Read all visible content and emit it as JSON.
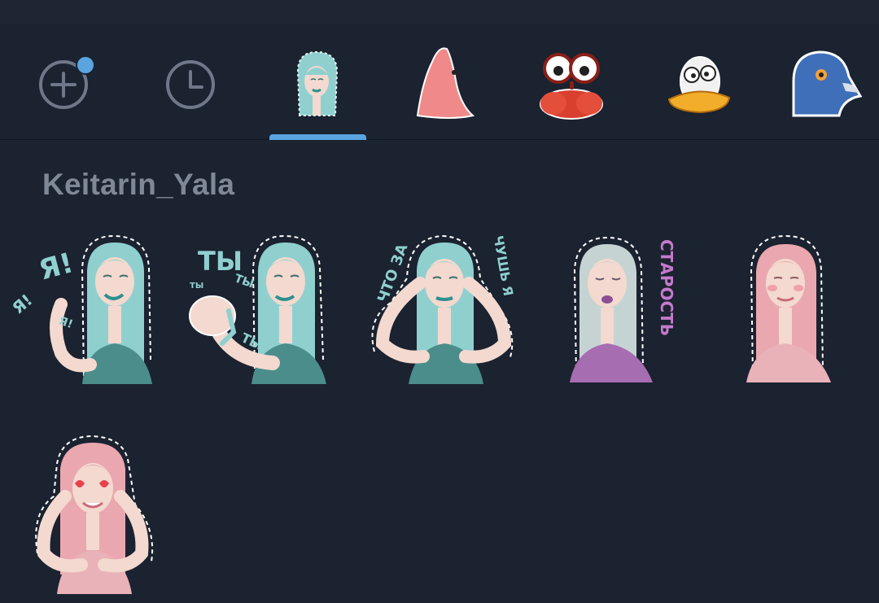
{
  "tabs": [
    {
      "name": "add",
      "icon": "add-circle-icon",
      "badge": true
    },
    {
      "name": "recent",
      "icon": "clock-icon"
    },
    {
      "name": "keitarin-yala-pack",
      "icon": "sticker-pack-thumbnail",
      "selected": true
    },
    {
      "name": "pink-starfish-pack",
      "icon": "sticker-pack-thumbnail"
    },
    {
      "name": "crab-pack",
      "icon": "sticker-pack-thumbnail"
    },
    {
      "name": "duck-pack",
      "icon": "sticker-pack-thumbnail"
    },
    {
      "name": "pigeon-pack",
      "icon": "sticker-pack-thumbnail"
    }
  ],
  "pack": {
    "title": "Keitarin_Yala"
  },
  "stickers": [
    {
      "id": 1,
      "texts": [
        "Я!",
        "Я!",
        "Я!"
      ],
      "hair_color": "#8fd0cf"
    },
    {
      "id": 2,
      "texts": [
        "ТЫ",
        "ТЫ",
        "ТЫ",
        "ТЫ"
      ],
      "hair_color": "#8fd0cf"
    },
    {
      "id": 3,
      "texts": [
        "ЧТО ЗА",
        "ЧУШЬ Я"
      ],
      "hair_color": "#8fd0cf"
    },
    {
      "id": 4,
      "texts": [
        "СТАРОСТЬ"
      ],
      "hair_color": "#c6d3d3"
    },
    {
      "id": 5,
      "texts": [],
      "hair_color": "#eaa7b0"
    },
    {
      "id": 6,
      "texts": [],
      "hair_color": "#eaa7b0"
    }
  ],
  "colors": {
    "background": "#1b2230",
    "accent": "#5aa4e0",
    "title_text": "#7f8896",
    "icon_gray": "#6e7888"
  }
}
